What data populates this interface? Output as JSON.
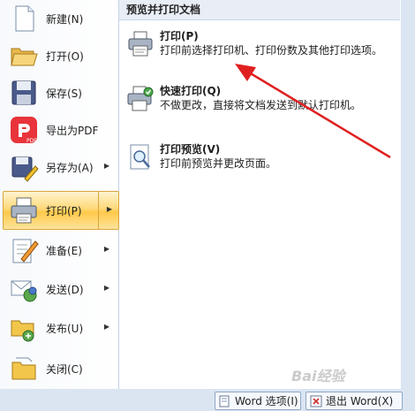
{
  "left_menu": {
    "items": [
      {
        "label": "新建(N)",
        "icon": "new-document-icon"
      },
      {
        "label": "打开(O)",
        "icon": "open-folder-icon"
      },
      {
        "label": "保存(S)",
        "icon": "save-disk-icon"
      },
      {
        "label": "导出为PDF",
        "icon": "pdf-icon"
      },
      {
        "label": "另存为(A)",
        "icon": "save-as-icon"
      },
      {
        "label": "打印(P)",
        "icon": "printer-icon"
      },
      {
        "label": "准备(E)",
        "icon": "prepare-icon"
      },
      {
        "label": "发送(D)",
        "icon": "send-icon"
      },
      {
        "label": "发布(U)",
        "icon": "publish-icon"
      },
      {
        "label": "关闭(C)",
        "icon": "close-folder-icon"
      }
    ],
    "pdf_badge": "PDF"
  },
  "right_panel": {
    "header": "预览并打印文档",
    "items": [
      {
        "title": "打印(P)",
        "desc": "打印前选择打印机、打印份数及其他打印选项。",
        "icon": "printer-icon"
      },
      {
        "title": "快速打印(Q)",
        "desc": "不做更改，直接将文档发送到默认打印机。",
        "icon": "quick-print-icon"
      },
      {
        "title": "打印预览(V)",
        "desc": "打印前预览并更改页面。",
        "icon": "print-preview-icon"
      }
    ]
  },
  "bottom_bar": {
    "options_label": "Word 选项(I)",
    "exit_label": "退出 Word(X)"
  },
  "watermark": "Bai经验",
  "colors": {
    "active_highlight": "#ffd97a",
    "annotation_arrow": "#e02020",
    "header_bg": "#e9eef6"
  }
}
